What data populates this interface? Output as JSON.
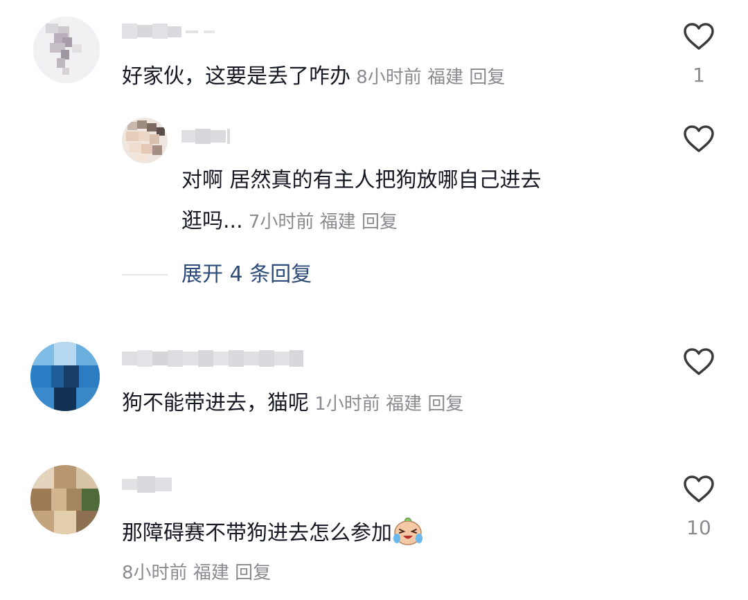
{
  "comments": [
    {
      "text": "好家伙，这要是丢了咋办",
      "time": "8小时前",
      "location": "福建",
      "reply_label": "回复",
      "likes": "1",
      "replies": [
        {
          "text_line1": "对啊 居然真的有主人把狗放哪自己进去",
          "text_line2": "逛吗...",
          "time": "7小时前",
          "location": "福建",
          "reply_label": "回复"
        }
      ],
      "expand_label": "展开 4 条回复"
    },
    {
      "text": "狗不能带进去，猫呢",
      "time": "1小时前",
      "location": "福建",
      "reply_label": "回复",
      "likes": ""
    },
    {
      "text": "那障碍赛不带狗进去怎么参加",
      "emoji": "crying-laughing-emoji",
      "time": "8小时前",
      "location": "福建",
      "reply_label": "回复",
      "likes": "10"
    }
  ],
  "icons": {
    "like": "heart-outline-icon"
  },
  "colors": {
    "text": "#161823",
    "meta": "#8a8b91",
    "expand": "#2c4a78",
    "heart_stroke": "#3a3a3a"
  }
}
